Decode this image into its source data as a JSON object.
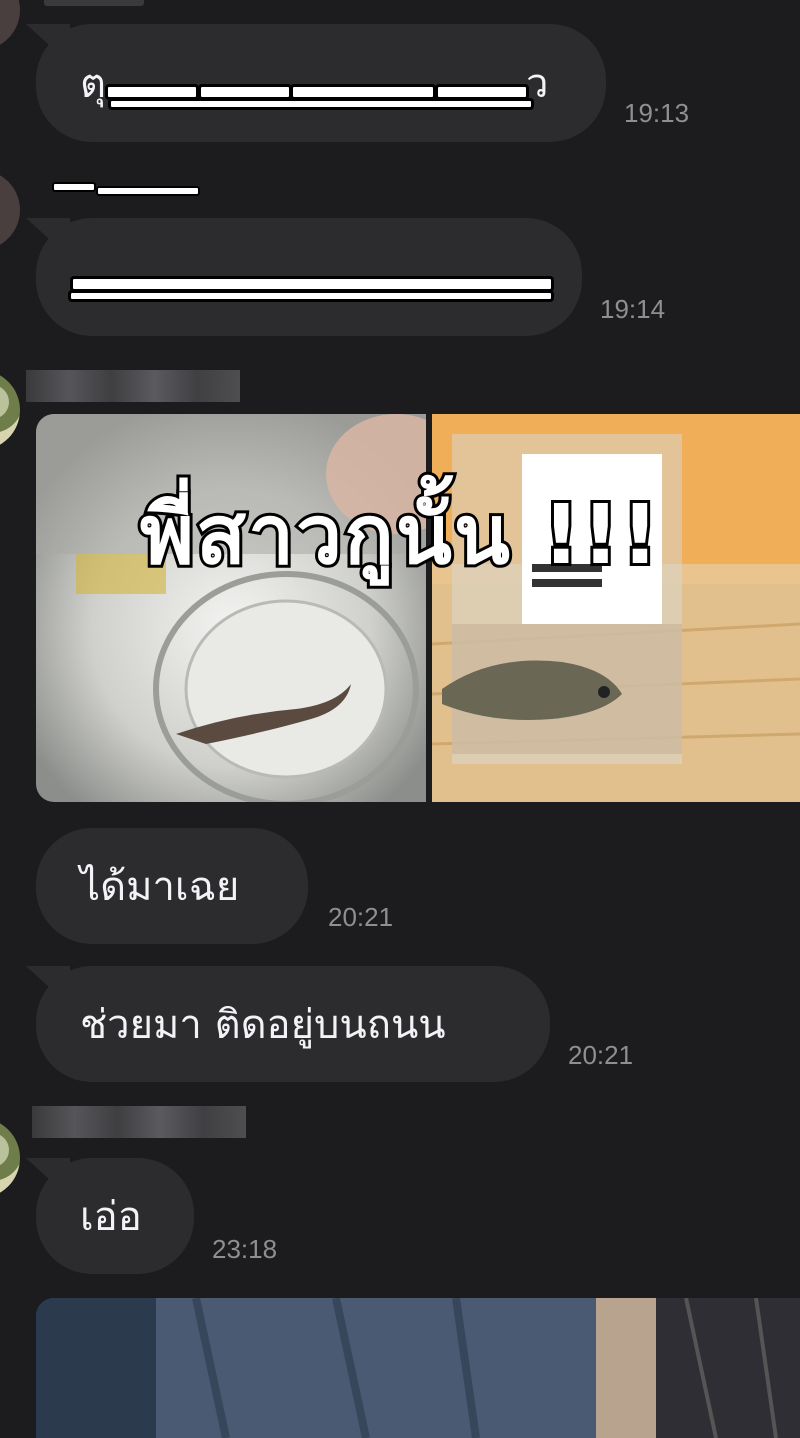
{
  "messages": [
    {
      "text": "ตุ",
      "text_end": "ว",
      "time": "19:13"
    },
    {
      "time": "19:14"
    },
    {
      "caption": "พี่สาวกูนั้น !!!"
    },
    {
      "text": "ได้มาเฉย",
      "time": "20:21"
    },
    {
      "text": "ช่วยมา ติดอยู่บนถนน",
      "time": "20:21"
    },
    {
      "text": "เอ่อ",
      "time": "23:18"
    }
  ],
  "icons": {
    "avatar_1": "avatar-icon",
    "avatar_2": "avatar-icon"
  },
  "colors": {
    "background": "#1c1c1e",
    "bubble": "#2c2c2e",
    "time": "#8e8e93"
  }
}
